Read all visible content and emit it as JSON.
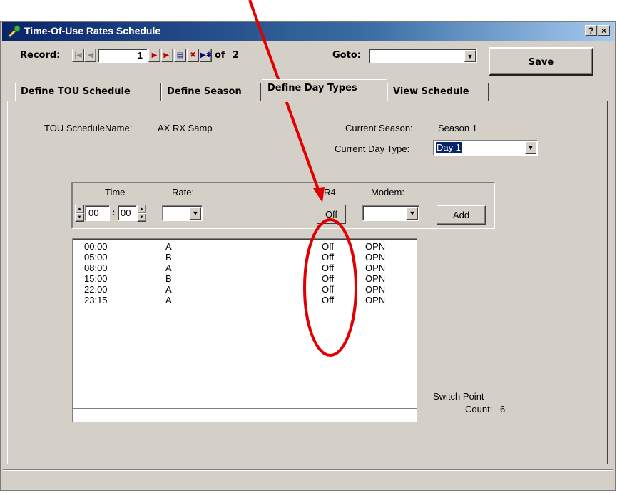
{
  "window": {
    "title": "Time-Of-Use Rates Schedule",
    "help_label": "?",
    "close_label": "×"
  },
  "toolbar": {
    "record_label": "Record:",
    "record_value": "1",
    "of_label": "of",
    "record_total": "2",
    "goto_label": "Goto:",
    "goto_value": "",
    "save_label": "Save"
  },
  "tabs": [
    {
      "label": "Define TOU Schedule"
    },
    {
      "label": "Define Season"
    },
    {
      "label": "Define Day Types"
    },
    {
      "label": "View Schedule"
    }
  ],
  "info": {
    "schedule_label": "TOU ScheduleName:",
    "schedule_value": "AX RX Samp",
    "season_label": "Current Season:",
    "season_value": "Season 1",
    "daytype_label": "Current Day Type:",
    "daytype_value": "Day 1"
  },
  "entry": {
    "time_label": "Time",
    "hour": "00",
    "minute": "00",
    "colon": ":",
    "rate_label": "Rate:",
    "rate_value": "",
    "r4_label": "R4",
    "r4_value": "Off",
    "modem_label": "Modem:",
    "modem_value": "",
    "add_label": "Add"
  },
  "switch_points": [
    {
      "time": "00:00",
      "rate": "A",
      "r4": "Off",
      "modem": "OPN"
    },
    {
      "time": "05:00",
      "rate": "B",
      "r4": "Off",
      "modem": "OPN"
    },
    {
      "time": "08:00",
      "rate": "A",
      "r4": "Off",
      "modem": "OPN"
    },
    {
      "time": "15:00",
      "rate": "B",
      "r4": "Off",
      "modem": "OPN"
    },
    {
      "time": "22:00",
      "rate": "A",
      "r4": "Off",
      "modem": "OPN"
    },
    {
      "time": "23:15",
      "rate": "A",
      "r4": "Off",
      "modem": "OPN"
    }
  ],
  "summary": {
    "label_line1": "Switch Point",
    "label_line2": "Count:",
    "count": "6"
  },
  "colors": {
    "annotation": "#e00000",
    "titlebar": "#0a246a",
    "face": "#d4d0c8"
  },
  "icons": [
    "app-icon",
    "help-icon",
    "close-icon",
    "first-record-icon",
    "prev-record-icon",
    "next-record-icon",
    "last-record-icon",
    "edit-record-icon",
    "delete-record-icon",
    "new-record-icon",
    "dropdown-arrow-icon"
  ]
}
